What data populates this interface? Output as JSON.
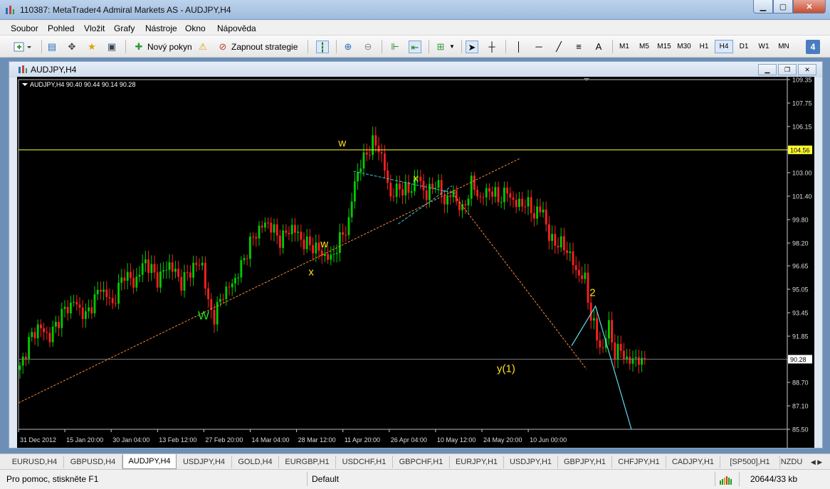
{
  "window": {
    "title": "110387: MetaTrader4 Admiral Markets AS - AUDJPY,H4"
  },
  "menu": [
    "Soubor",
    "Pohled",
    "Vložit",
    "Grafy",
    "Nástroje",
    "Okno",
    "Nápověda"
  ],
  "toolbar": {
    "new_order": "Nový pokyn",
    "autotrading": "Zapnout strategie",
    "timeframes": [
      "M1",
      "M5",
      "M15",
      "M30",
      "H1",
      "H4",
      "D1",
      "W1",
      "MN"
    ],
    "active_timeframe": "H4",
    "text_tool": "A",
    "badge": "4"
  },
  "chart_window": {
    "title": "AUDJPY,H4"
  },
  "chart_data": {
    "type": "candlestick",
    "symbol_label": "AUDJPY,H4  90.40 90.44 90.14 90.28",
    "ylim": [
      85.5,
      109.35
    ],
    "y_ticks": [
      "109.35",
      "107.75",
      "106.15",
      "104.55",
      "103.00",
      "101.40",
      "99.80",
      "98.20",
      "96.65",
      "95.05",
      "93.45",
      "91.85",
      "90.25",
      "88.70",
      "87.10",
      "85.50"
    ],
    "x_ticks": [
      "31 Dec 2012",
      "15 Jan 20:00",
      "30 Jan 04:00",
      "13 Feb 12:00",
      "27 Feb 20:00",
      "14 Mar 04:00",
      "28 Mar 12:00",
      "11 Apr 20:00",
      "26 Apr 04:00",
      "10 May 12:00",
      "24 May 20:00",
      "10 Jun 00:00"
    ],
    "price_path": [
      [
        0,
        89.6
      ],
      [
        3,
        91.5
      ],
      [
        6,
        92.5
      ],
      [
        10,
        91.8
      ],
      [
        14,
        93.4
      ],
      [
        18,
        94.2
      ],
      [
        22,
        93.2
      ],
      [
        27,
        95.2
      ],
      [
        31,
        94.0
      ],
      [
        35,
        96.2
      ],
      [
        38,
        95.4
      ],
      [
        42,
        97.0
      ],
      [
        46,
        95.7
      ],
      [
        50,
        96.8
      ],
      [
        54,
        95.5
      ],
      [
        58,
        96.6
      ],
      [
        61,
        96.8
      ],
      [
        63,
        94.0
      ],
      [
        65,
        93.2
      ],
      [
        68,
        94.8
      ],
      [
        71,
        95.4
      ],
      [
        74,
        96.6
      ],
      [
        77,
        98.2
      ],
      [
        80,
        99.2
      ],
      [
        83,
        99.6
      ],
      [
        87,
        98.4
      ],
      [
        91,
        99.3
      ],
      [
        95,
        98.2
      ],
      [
        98,
        98.0
      ],
      [
        101,
        97.5
      ],
      [
        104,
        97.1
      ],
      [
        107,
        98.4
      ],
      [
        110,
        99.6
      ],
      [
        112,
        102.5
      ],
      [
        115,
        104.0
      ],
      [
        118,
        105.0
      ],
      [
        120,
        104.8
      ],
      [
        122,
        103.2
      ],
      [
        124,
        101.4
      ],
      [
        127,
        102.0
      ],
      [
        130,
        101.7
      ],
      [
        133,
        102.8
      ],
      [
        136,
        101.4
      ],
      [
        139,
        102.4
      ],
      [
        142,
        101.1
      ],
      [
        145,
        101.6
      ],
      [
        148,
        100.3
      ],
      [
        151,
        102.3
      ],
      [
        154,
        101.2
      ],
      [
        157,
        101.9
      ],
      [
        160,
        101.2
      ],
      [
        163,
        101.7
      ],
      [
        166,
        100.8
      ],
      [
        169,
        101.0
      ],
      [
        172,
        100.2
      ],
      [
        175,
        100.5
      ],
      [
        177,
        98.5
      ],
      [
        180,
        98.2
      ],
      [
        183,
        97.8
      ],
      [
        186,
        96.3
      ],
      [
        189,
        95.7
      ],
      [
        191,
        93.2
      ],
      [
        193,
        91.8
      ],
      [
        195,
        90.8
      ],
      [
        197,
        92.8
      ],
      [
        199,
        90.4
      ],
      [
        201,
        91.2
      ],
      [
        203,
        89.9
      ],
      [
        205,
        90.5
      ],
      [
        207,
        90.0
      ],
      [
        209,
        90.28
      ]
    ],
    "last_price": "90.28",
    "hline_price": "104.56",
    "labels": [
      {
        "text": "W",
        "kind": "green"
      },
      {
        "text": "w",
        "kind": "yellow"
      },
      {
        "text": "x",
        "kind": "yellow"
      },
      {
        "text": "w",
        "kind": "yellow"
      },
      {
        "text": "x",
        "kind": "yellow"
      },
      {
        "text": "y(1)",
        "kind": "yellow"
      },
      {
        "text": "2",
        "kind": "yellow"
      }
    ],
    "colors": {
      "bull": "#00cc00",
      "bear": "#ff2020",
      "trend": "#ff8c3a",
      "channel": "#40c8d8",
      "projection": "#5fe0f0",
      "hline": "#ffff33"
    }
  },
  "tabs": {
    "items": [
      "EURUSD,H4",
      "GBPUSD,H4",
      "AUDJPY,H4",
      "USDJPY,H4",
      "GOLD,H4",
      "EURGBP,H1",
      "USDCHF,H1",
      "GBPCHF,H1",
      "EURJPY,H1",
      "USDJPY,H1",
      "GBPJPY,H1",
      "CHFJPY,H1",
      "CADJPY,H1",
      "[SP500],H1",
      "NZDU"
    ],
    "active": "AUDJPY,H4"
  },
  "status": {
    "help": "Pro pomoc, stiskněte F1",
    "profile": "Default",
    "traffic": "20644/33 kb"
  }
}
